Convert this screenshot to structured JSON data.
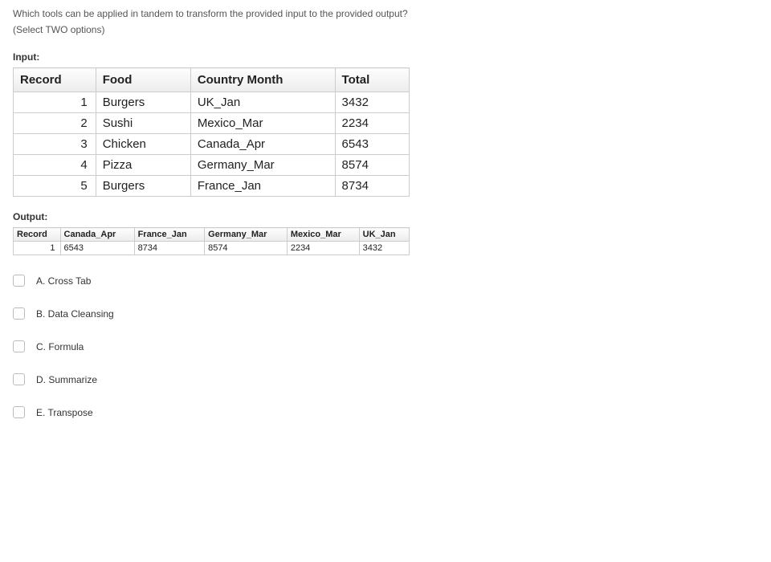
{
  "question": {
    "text": "Which tools can be applied in tandem to transform the provided input to the provided output?",
    "instruction": "(Select TWO options)"
  },
  "sections": {
    "input_label": "Input:",
    "output_label": "Output:"
  },
  "input_table": {
    "headers": {
      "record": "Record",
      "food": "Food",
      "country_month": "Country Month",
      "total": "Total"
    },
    "rows": [
      {
        "record": "1",
        "food": "Burgers",
        "country_month": "UK_Jan",
        "total": "3432"
      },
      {
        "record": "2",
        "food": "Sushi",
        "country_month": "Mexico_Mar",
        "total": "2234"
      },
      {
        "record": "3",
        "food": "Chicken",
        "country_month": "Canada_Apr",
        "total": "6543"
      },
      {
        "record": "4",
        "food": "Pizza",
        "country_month": "Germany_Mar",
        "total": "8574"
      },
      {
        "record": "5",
        "food": "Burgers",
        "country_month": "France_Jan",
        "total": "8734"
      }
    ]
  },
  "output_table": {
    "headers": {
      "record": "Record",
      "canada_apr": "Canada_Apr",
      "france_jan": "France_Jan",
      "germany_mar": "Germany_Mar",
      "mexico_mar": "Mexico_Mar",
      "uk_jan": "UK_Jan"
    },
    "row": {
      "record": "1",
      "canada_apr": "6543",
      "france_jan": "8734",
      "germany_mar": "8574",
      "mexico_mar": "2234",
      "uk_jan": "3432"
    }
  },
  "options": {
    "a": "A. Cross Tab",
    "b": "B. Data Cleansing",
    "c": "C. Formula",
    "d": "D. Summarize",
    "e": "E. Transpose"
  }
}
